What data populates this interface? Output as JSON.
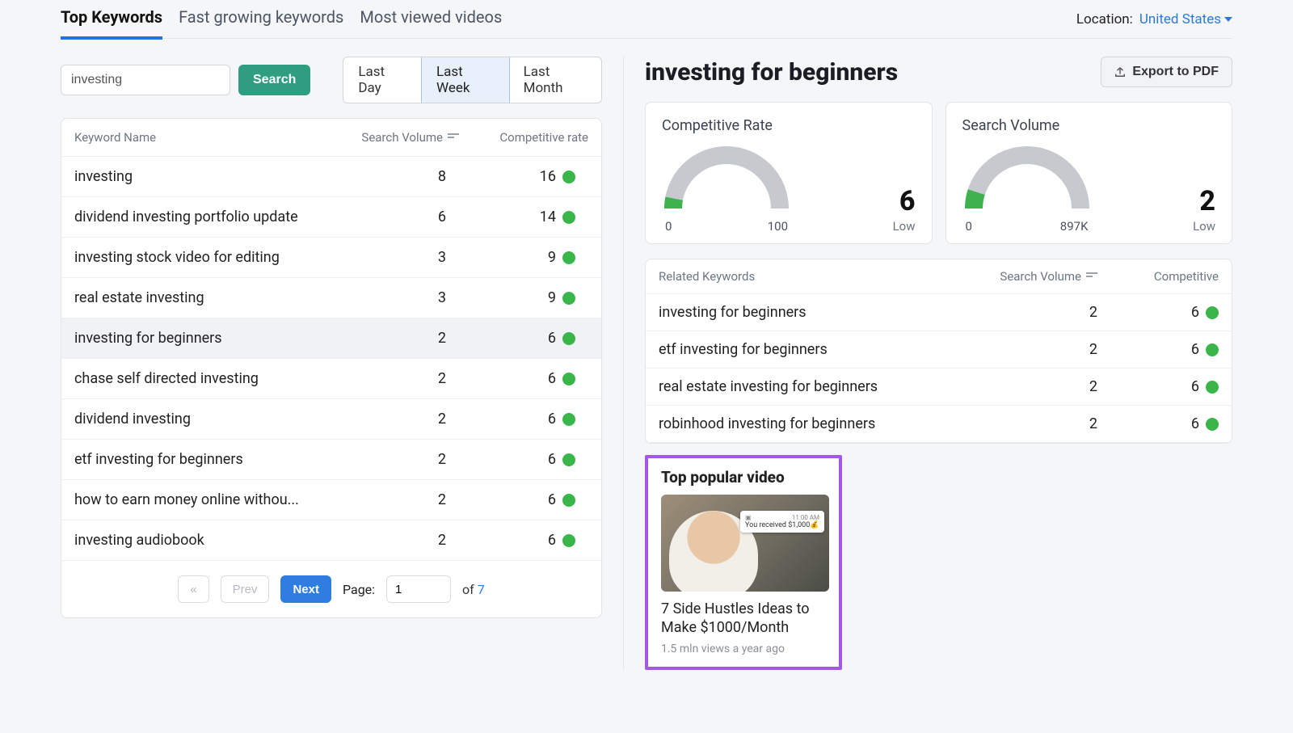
{
  "tabs": {
    "items": [
      "Top Keywords",
      "Fast growing keywords",
      "Most viewed videos"
    ],
    "active": 0
  },
  "location": {
    "label": "Location:",
    "value": "United States"
  },
  "search": {
    "value": "investing",
    "button": "Search"
  },
  "timerange": {
    "options": [
      "Last Day",
      "Last Week",
      "Last Month"
    ],
    "active": 1
  },
  "left_table": {
    "headers": {
      "kw": "Keyword Name",
      "sv": "Search Volume",
      "cr": "Competitive rate"
    },
    "rows": [
      {
        "kw": "investing",
        "sv": 8,
        "cr": 16
      },
      {
        "kw": "dividend investing portfolio update",
        "sv": 6,
        "cr": 14
      },
      {
        "kw": "investing stock video for editing",
        "sv": 3,
        "cr": 9
      },
      {
        "kw": "real estate investing",
        "sv": 3,
        "cr": 9
      },
      {
        "kw": "investing for beginners",
        "sv": 2,
        "cr": 6
      },
      {
        "kw": "chase self directed investing",
        "sv": 2,
        "cr": 6
      },
      {
        "kw": "dividend investing",
        "sv": 2,
        "cr": 6
      },
      {
        "kw": "etf investing for beginners",
        "sv": 2,
        "cr": 6
      },
      {
        "kw": "how to earn money online withou...",
        "sv": 2,
        "cr": 6
      },
      {
        "kw": "investing audiobook",
        "sv": 2,
        "cr": 6
      }
    ],
    "selected": 4
  },
  "pager": {
    "first": "«",
    "prev": "Prev",
    "next": "Next",
    "page_label": "Page:",
    "page": "1",
    "of": "of",
    "total": "7"
  },
  "detail": {
    "title": "investing for beginners",
    "export": "Export to PDF",
    "gauges": {
      "cr": {
        "title": "Competitive Rate",
        "min": "0",
        "max": "100",
        "value": "6",
        "level": "Low",
        "fill_pct": 6
      },
      "sv": {
        "title": "Search Volume",
        "min": "0",
        "max": "897K",
        "value": "2",
        "level": "Low",
        "fill_pct": 10
      }
    },
    "related": {
      "headers": {
        "kw": "Related Keywords",
        "sv": "Search Volume",
        "cr": "Competitive"
      },
      "rows": [
        {
          "kw": "investing for beginners",
          "sv": 2,
          "cr": 6
        },
        {
          "kw": "etf investing for beginners",
          "sv": 2,
          "cr": 6
        },
        {
          "kw": "real estate investing for beginners",
          "sv": 2,
          "cr": 6
        },
        {
          "kw": "robinhood investing for beginners",
          "sv": 2,
          "cr": 6
        }
      ]
    },
    "video": {
      "heading": "Top popular video",
      "popup_time": "11:00 AM",
      "popup_text": "You received $1,000💰",
      "title": "7 Side Hustles Ideas to Make $1000/Month",
      "meta": "1.5 mln views a year ago"
    }
  },
  "chart_data": [
    {
      "type": "gauge",
      "title": "Competitive Rate",
      "min": 0,
      "max": 100,
      "value": 6,
      "label": "Low"
    },
    {
      "type": "gauge",
      "title": "Search Volume",
      "min": 0,
      "max": 897000,
      "value": 2,
      "label": "Low"
    }
  ]
}
